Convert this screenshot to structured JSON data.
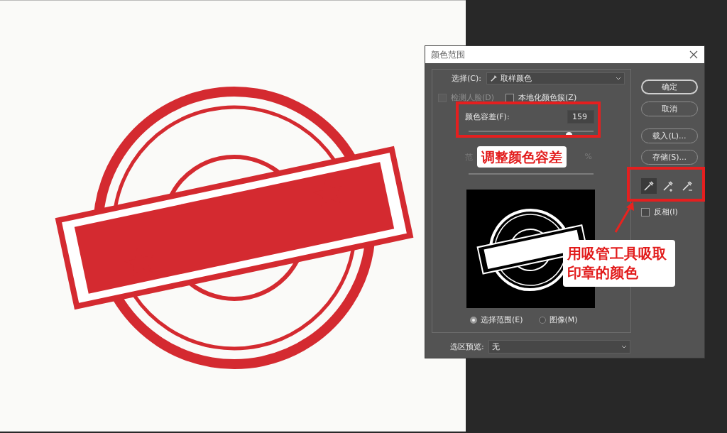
{
  "dialog": {
    "title": "颜色范围",
    "select": {
      "label": "选择(C):",
      "value": "取样颜色"
    },
    "options": [
      {
        "label": "检测人脸(D)",
        "checked": false,
        "disabled": true
      },
      {
        "label": "本地化颜色簇(Z)",
        "checked": false,
        "disabled": false
      }
    ],
    "fuzziness": {
      "label": "颜色容差(F):",
      "value": "159",
      "level": 0.8
    },
    "range": {
      "label": "范",
      "unit": "%"
    },
    "view_options": [
      {
        "label": "选择范围(E)",
        "selected": true
      },
      {
        "label": "图像(M)",
        "selected": false
      }
    ],
    "selection_preview": {
      "label": "选区预览:",
      "value": "无"
    },
    "buttons": [
      {
        "label": "确定",
        "default": true
      },
      {
        "label": "取消",
        "default": false
      },
      {
        "label": "载入(L)...",
        "default": false
      },
      {
        "label": "存储(S)...",
        "default": false
      }
    ],
    "eyedroppers": [
      {
        "kind": "sample",
        "selected": true
      },
      {
        "kind": "add",
        "selected": false
      },
      {
        "kind": "subtract",
        "selected": false
      }
    ],
    "invert": {
      "label": "反相(I)",
      "checked": false
    }
  },
  "callouts": [
    {
      "text": "调整颜色容差"
    },
    {
      "text": "用吸管工具吸取印章的颜色"
    }
  ]
}
